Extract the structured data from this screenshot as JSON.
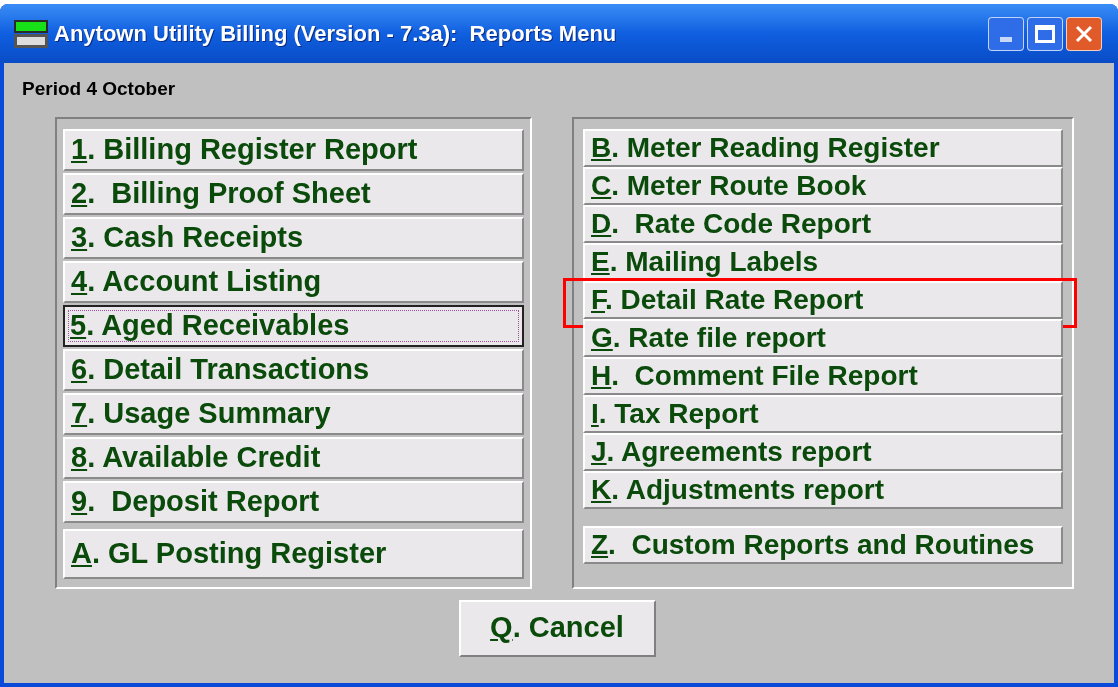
{
  "window": {
    "title": "Anytown Utility Billing (Version - 7.3a):  Reports Menu"
  },
  "period": "Period 4 October",
  "left_buttons": [
    {
      "text": "1. Billing Register Report",
      "focused": false,
      "highlighted": false
    },
    {
      "text": "2.  Billing Proof Sheet",
      "focused": false,
      "highlighted": false
    },
    {
      "text": "3. Cash Receipts",
      "focused": false,
      "highlighted": false
    },
    {
      "text": "4. Account Listing",
      "focused": false,
      "highlighted": false
    },
    {
      "text": "5. Aged Receivables",
      "focused": true,
      "highlighted": false
    },
    {
      "text": "6. Detail Transactions",
      "focused": false,
      "highlighted": false
    },
    {
      "text": "7. Usage Summary",
      "focused": false,
      "highlighted": false
    },
    {
      "text": "8. Available Credit",
      "focused": false,
      "highlighted": false
    },
    {
      "text": "9.  Deposit Report",
      "focused": false,
      "highlighted": false
    },
    {
      "text": "A. GL Posting Register",
      "focused": false,
      "highlighted": false
    }
  ],
  "right_buttons": [
    {
      "text": "B. Meter Reading Register",
      "focused": false,
      "highlighted": false
    },
    {
      "text": "C. Meter Route Book",
      "focused": false,
      "highlighted": false
    },
    {
      "text": "D.  Rate Code Report",
      "focused": false,
      "highlighted": false
    },
    {
      "text": "E. Mailing Labels",
      "focused": false,
      "highlighted": false
    },
    {
      "text": "F. Detail Rate Report",
      "focused": false,
      "highlighted": true
    },
    {
      "text": "G. Rate file report",
      "focused": false,
      "highlighted": false
    },
    {
      "text": "H.  Comment File Report",
      "focused": false,
      "highlighted": false
    },
    {
      "text": "I. Tax Report",
      "focused": false,
      "highlighted": false
    },
    {
      "text": "J. Agreements report",
      "focused": false,
      "highlighted": false
    },
    {
      "text": "K. Adjustments report",
      "focused": false,
      "highlighted": false
    },
    {
      "text": "Z.  Custom Reports and Routines",
      "focused": false,
      "highlighted": false
    }
  ],
  "cancel_button": "Q. Cancel"
}
